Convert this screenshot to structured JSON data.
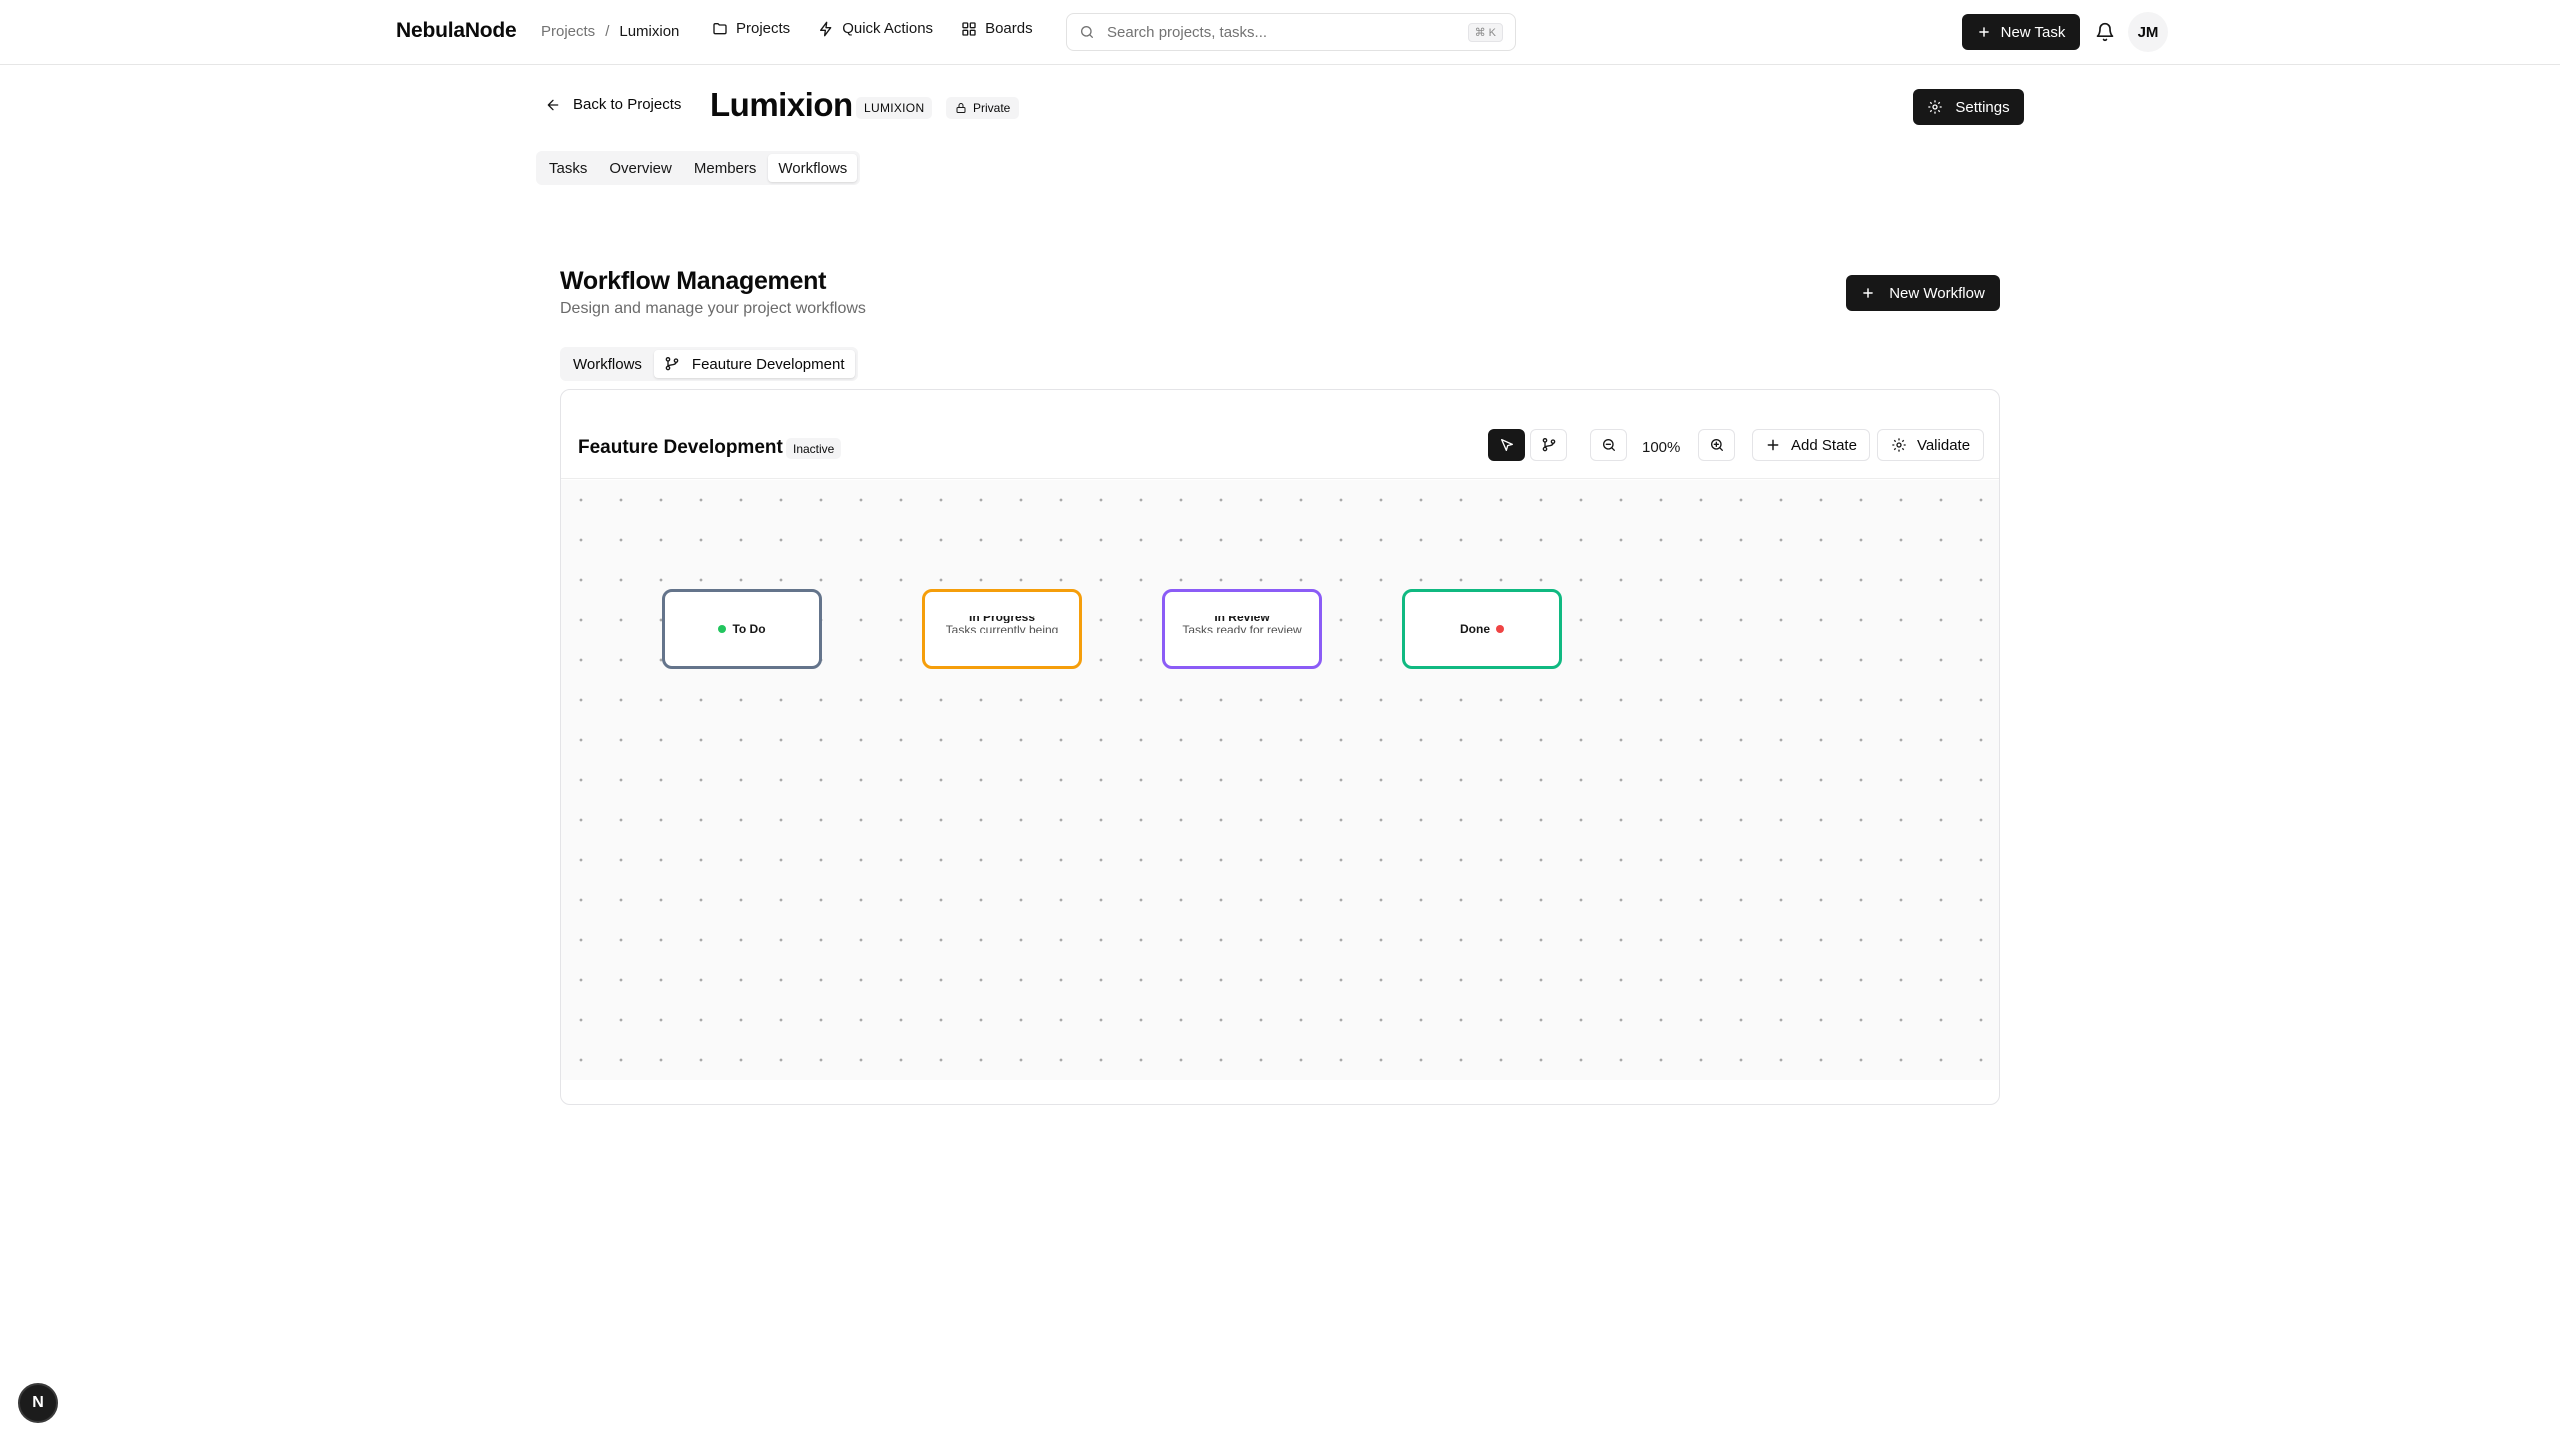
{
  "header": {
    "brand": "NebulaNode",
    "breadcrumb": {
      "parent": "Projects",
      "separator": "/",
      "current": "Lumixion"
    },
    "nav": [
      {
        "label": "Projects",
        "icon": "folder-icon"
      },
      {
        "label": "Quick Actions",
        "icon": "zap-icon"
      },
      {
        "label": "Boards",
        "icon": "grid-icon"
      }
    ],
    "search": {
      "placeholder": "Search projects, tasks...",
      "value": "",
      "shortcut": "⌘ K"
    },
    "new_task_label": "New Task",
    "avatar_initials": "JM"
  },
  "project": {
    "back_label": "Back to Projects",
    "title": "Lumixion",
    "key": "LUMIXION",
    "visibility": "Private",
    "settings_label": "Settings",
    "tabs": [
      "Tasks",
      "Overview",
      "Members",
      "Workflows"
    ],
    "active_tab": "Workflows"
  },
  "workflow_section": {
    "title": "Workflow Management",
    "subtitle": "Design and manage your project workflows",
    "new_workflow_label": "New Workflow",
    "tabs": [
      "Workflows",
      "Feauture Development"
    ],
    "active_tab": "Feauture Development"
  },
  "editor": {
    "workflow_name": "Feauture Development",
    "status": "Inactive",
    "zoom": "100%",
    "add_state_label": "Add State",
    "validate_label": "Validate",
    "nodes": [
      {
        "name": "To Do",
        "description": "",
        "border_color": "#64748b",
        "dot_color": "#22c55e",
        "dot_position": "before"
      },
      {
        "name": "In Progress",
        "description": "Tasks currently being",
        "border_color": "#f59e0b",
        "dot_color": "",
        "dot_position": ""
      },
      {
        "name": "In Review",
        "description": "Tasks ready for review",
        "border_color": "#8b5cf6",
        "dot_color": "",
        "dot_position": ""
      },
      {
        "name": "Done",
        "description": "",
        "border_color": "#10b981",
        "dot_color": "#ef4444",
        "dot_position": "after"
      }
    ]
  },
  "fab_label": "N",
  "colors": {
    "primary": "#171717",
    "canvas": "#fafafa",
    "border": "#e4e4e7"
  }
}
